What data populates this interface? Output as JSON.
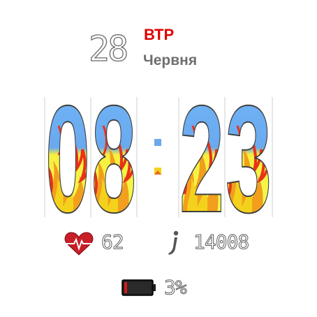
{
  "date": {
    "day": "28",
    "weekday": "ВТР",
    "month": "Червня"
  },
  "time": {
    "hours": "08",
    "minutes": "23",
    "separator": ":"
  },
  "heart_rate": {
    "value": "62",
    "icon": "heart-icon"
  },
  "steps": {
    "value": "14008",
    "icon": "walking-person-icon"
  },
  "battery": {
    "value": "3%",
    "icon": "battery-icon",
    "level": 0.03
  },
  "colors": {
    "flag_blue": "#5aa7f2",
    "flag_yellow": "#f4f24b",
    "accent_red": "#e00000",
    "outline_gray": "#5c5c5c"
  }
}
